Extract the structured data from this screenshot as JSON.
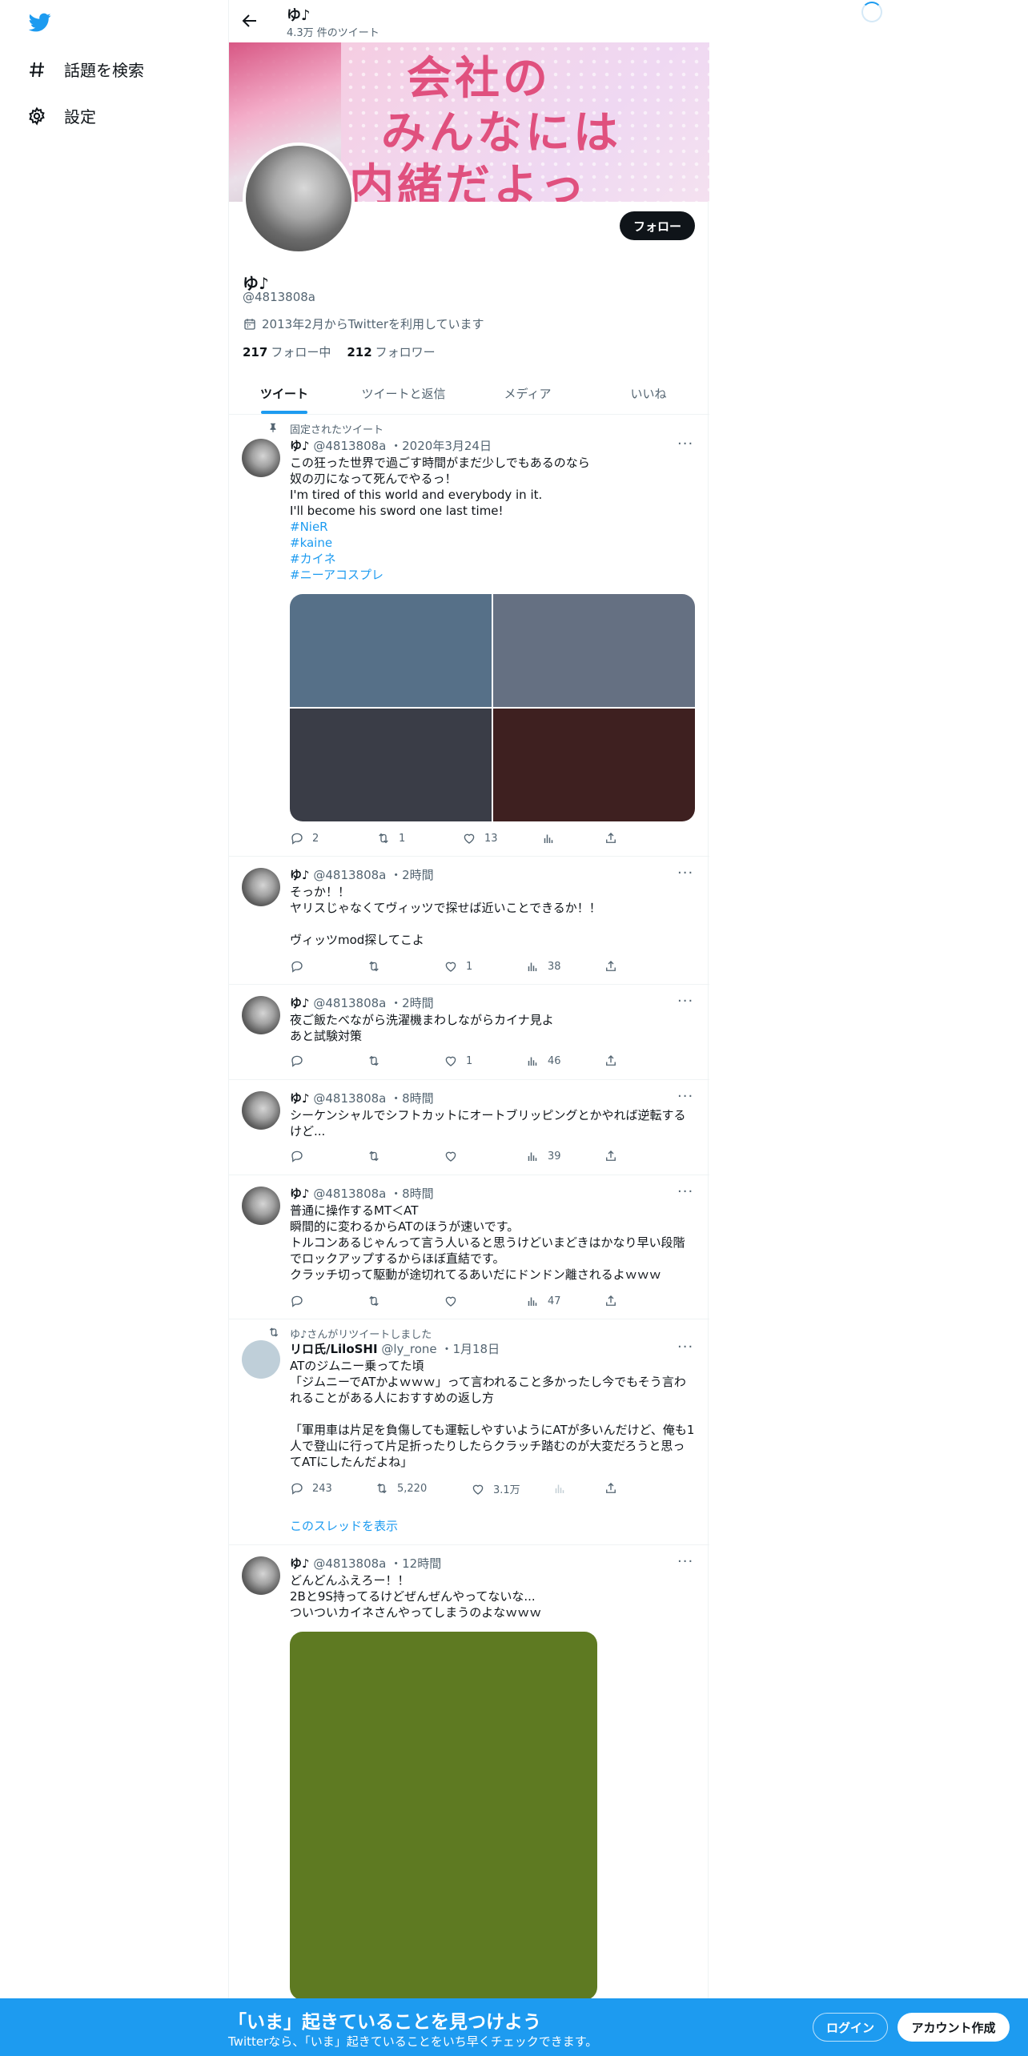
{
  "sidebar": {
    "items": [
      {
        "label": "話題を検索",
        "icon": "hashtag-icon"
      },
      {
        "label": "設定",
        "icon": "gear-icon"
      }
    ]
  },
  "header": {
    "name": "ゆ♪",
    "tweet_count": "4.3万 件のツイート"
  },
  "banner": {
    "line1": "会社の",
    "line2": "みんなには",
    "line3": "内緒だよっ"
  },
  "profile": {
    "follow_label": "フォロー",
    "name": "ゆ♪",
    "handle": "@4813808a",
    "joined": "2013年2月からTwitterを利用しています",
    "following_count": "217",
    "following_label": "フォロー中",
    "followers_count": "212",
    "followers_label": "フォロワー"
  },
  "tabs": [
    "ツイート",
    "ツイートと返信",
    "メディア",
    "いいね"
  ],
  "tweets": {
    "t1": {
      "context": "固定されたツイート",
      "name": "ゆ♪",
      "handle": "@4813808a",
      "time": "・2020年3月24日",
      "lines": [
        "この狂った世界で過ごす時間がまだ少しでもあるのなら",
        "奴の刃になって死んでやるっ！",
        "I'm tired of this world and everybody in it.",
        "I'll become his sword one last time!"
      ],
      "tags": [
        "#NieR",
        "#kaine",
        "#カイネ",
        "#ニーアコスプレ"
      ],
      "media_colors": [
        "#567088",
        "#657082",
        "#3a3d47",
        "#3e2020"
      ],
      "reply": "2",
      "retweet": "1",
      "like": "13",
      "views": ""
    },
    "t2": {
      "name": "ゆ♪",
      "handle": "@4813808a",
      "time": "・2時間",
      "lines": [
        "そっか！！",
        "ヤリスじゃなくてヴィッツで探せば近いことできるか！！",
        "",
        "ヴィッツmod探してこよ"
      ],
      "reply": "",
      "retweet": "",
      "like": "1",
      "views": "38"
    },
    "t3": {
      "name": "ゆ♪",
      "handle": "@4813808a",
      "time": "・2時間",
      "lines": [
        "夜ご飯たべながら洗濯機まわしながらカイナ見よ",
        "あと試験対策"
      ],
      "reply": "",
      "retweet": "",
      "like": "1",
      "views": "46"
    },
    "t4": {
      "name": "ゆ♪",
      "handle": "@4813808a",
      "time": "・8時間",
      "lines": [
        "シーケンシャルでシフトカットにオートブリッピングとかやれば逆転する",
        "けど..."
      ],
      "reply": "",
      "retweet": "",
      "like": "",
      "views": "39"
    },
    "t5": {
      "name": "ゆ♪",
      "handle": "@4813808a",
      "time": "・8時間",
      "lines": [
        "普通に操作するMT＜AT",
        "瞬間的に変わるからATのほうが速いです。",
        "トルコンあるじゃんって言う人いると思うけどいまどきはかなり早い段階",
        "でロックアップするからほぼ直結です。",
        "クラッチ切って駆動が途切れてるあいだにドンドン離されるよｗｗｗ"
      ],
      "reply": "",
      "retweet": "",
      "like": "",
      "views": "47"
    },
    "t6": {
      "context": "ゆ♪さんがリツイートしました",
      "name": "リロ氏/LiloSHI",
      "handle": "@ly_rone",
      "time": "・1月18日",
      "lines": [
        "ATのジムニー乗ってた頃",
        "「ジムニーでATかよｗｗｗ」って言われること多かったし今でもそう言わ",
        "れることがある人におすすめの返し方",
        "",
        "「軍用車は片足を負傷しても運転しやすいようにATが多いんだけど、俺も1",
        "人で登山に行って片足折ったりしたらクラッチ踏むのが大変だろうと思っ",
        "てATにしたんだよね」"
      ],
      "reply": "243",
      "retweet": "5,220",
      "like": "3.1万",
      "views": "",
      "show_thread": "このスレッドを表示"
    },
    "t7": {
      "name": "ゆ♪",
      "handle": "@4813808a",
      "time": "・12時間",
      "lines": [
        "どんどんふえろー！！",
        "2Bと9S持ってるけどぜんぜんやってないな...",
        "ついついカイネさんやってしまうのよなｗｗｗ"
      ],
      "media_color": "#5e7a22"
    }
  },
  "bottom_bar": {
    "title": "「いま」起きていることを見つけよう",
    "subtitle": "Twitterなら、「いま」起きていることをいち早くチェックできます。",
    "login": "ログイン",
    "signup": "アカウント作成"
  },
  "colors": {
    "accent": "#1d9bf0",
    "text": "#0f1419",
    "muted": "#536471"
  }
}
